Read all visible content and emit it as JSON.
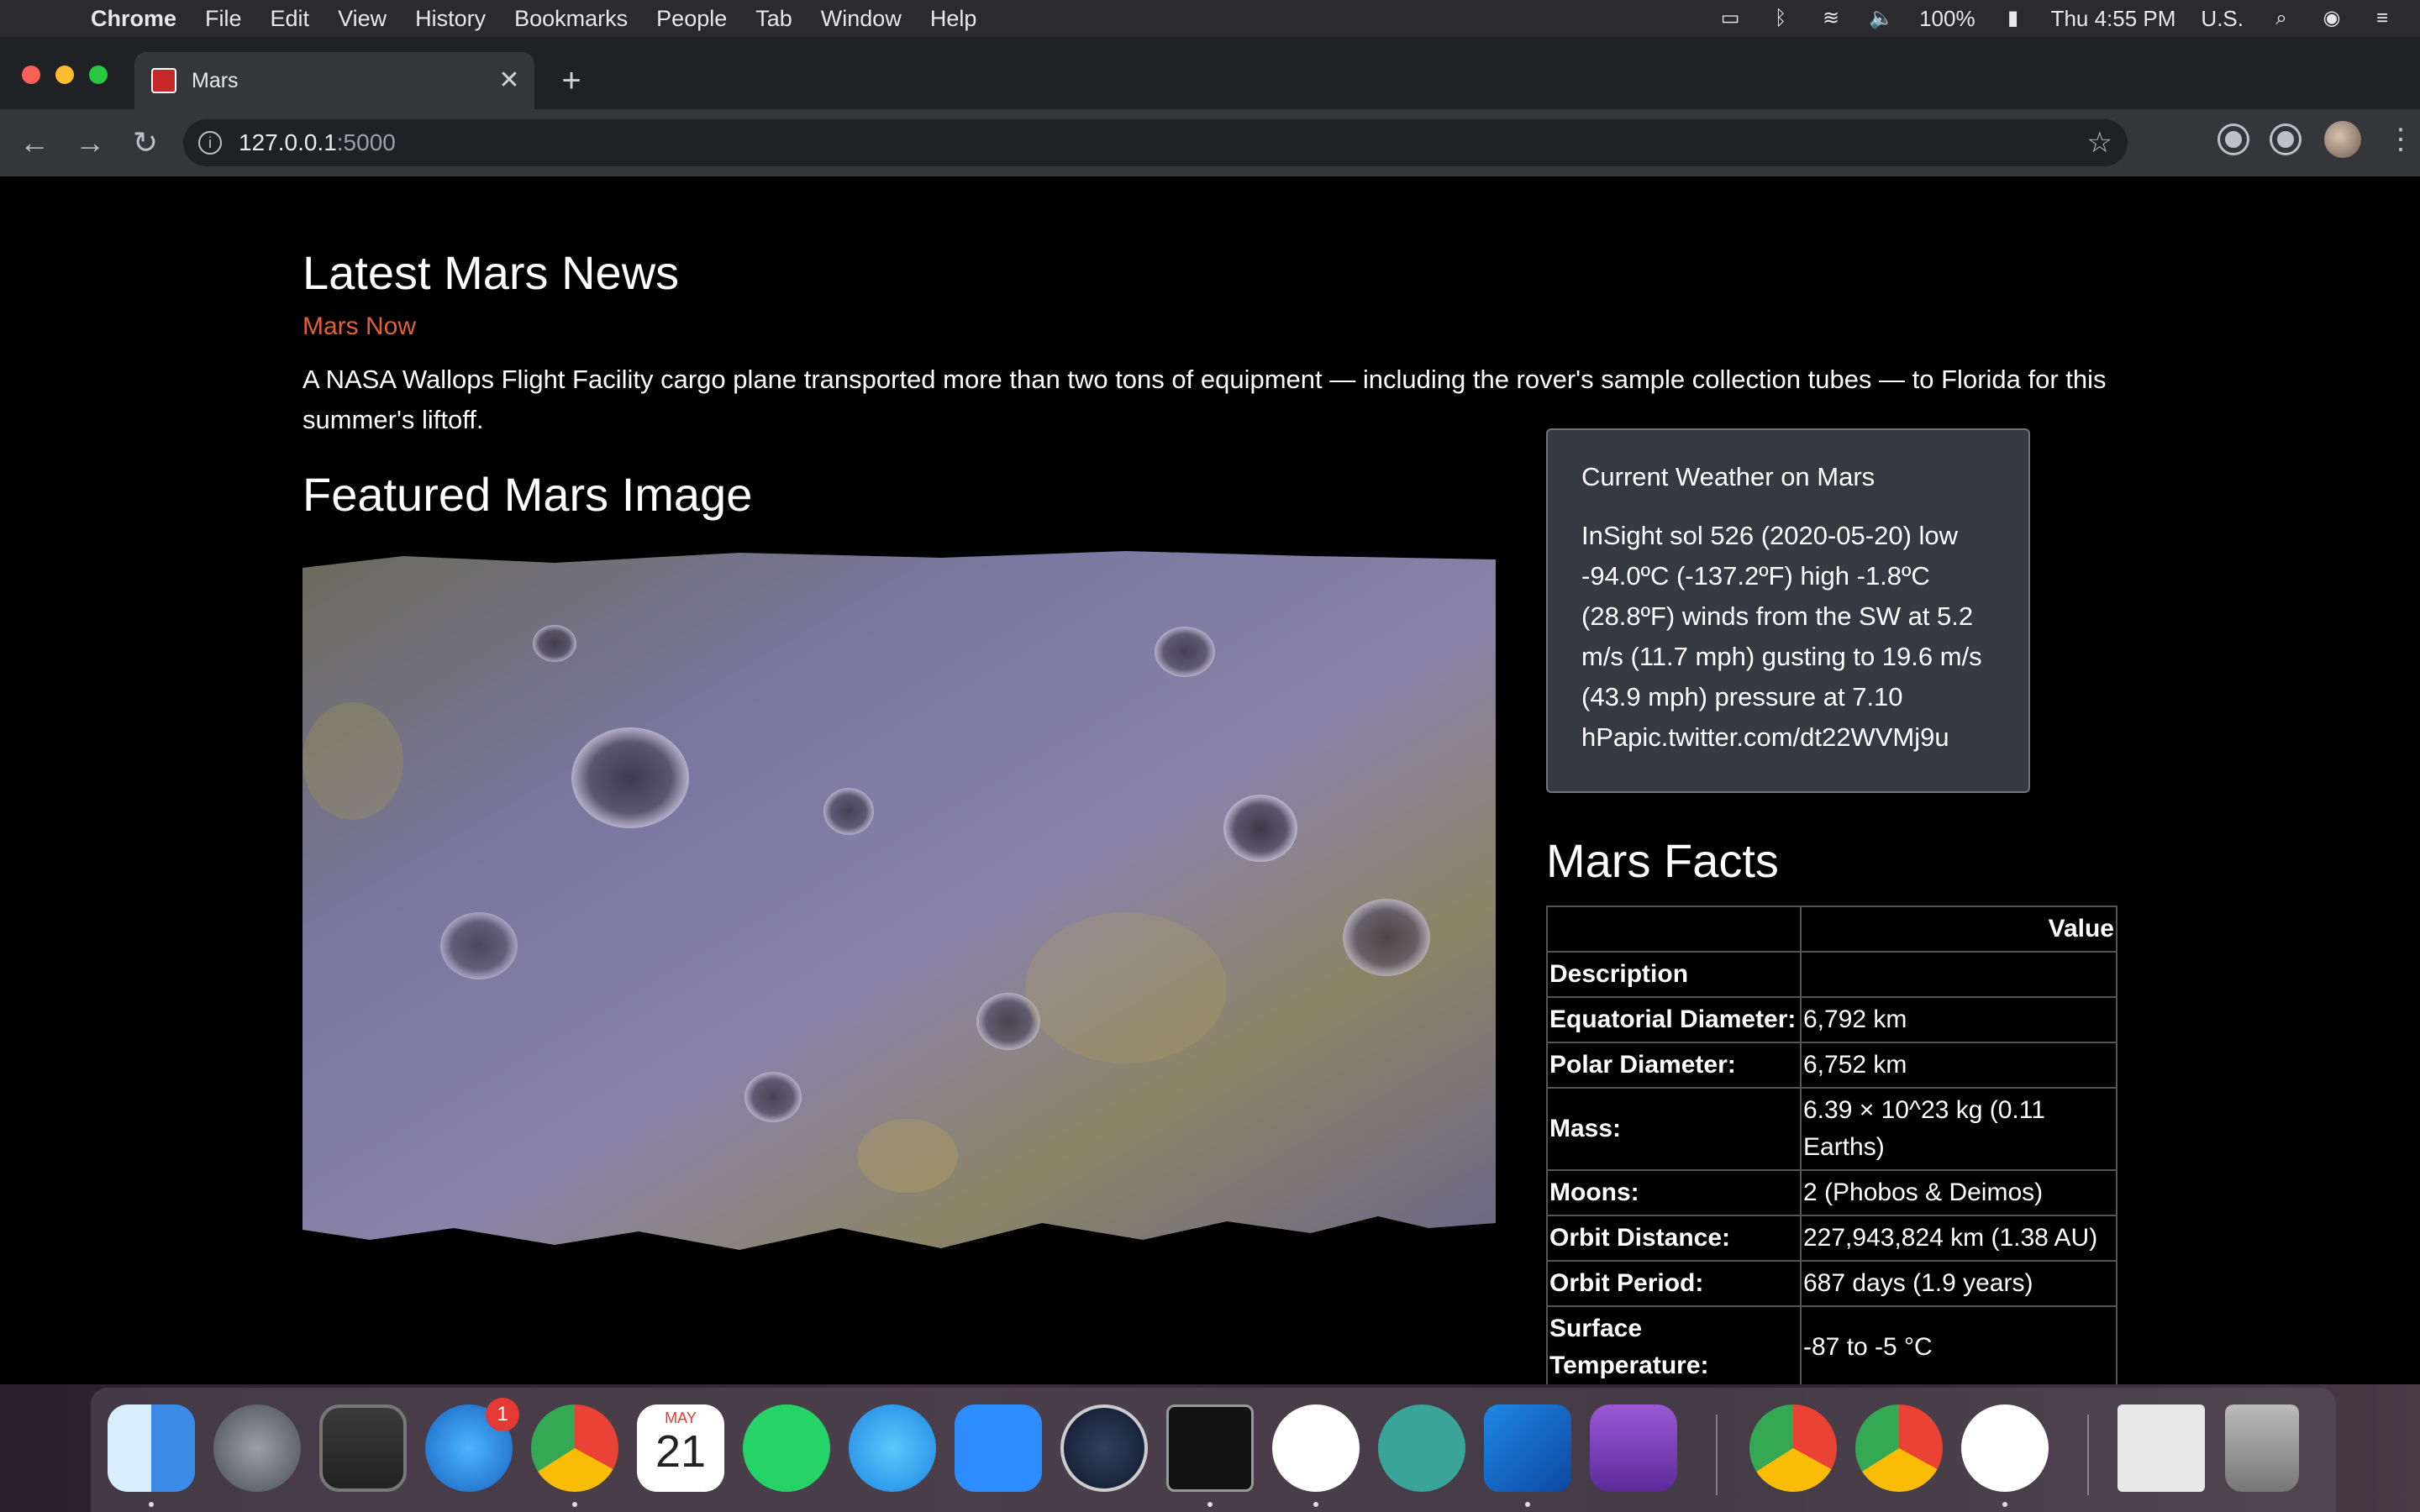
{
  "menubar": {
    "app_name": "Chrome",
    "items": [
      "File",
      "Edit",
      "View",
      "History",
      "Bookmarks",
      "People",
      "Tab",
      "Window",
      "Help"
    ],
    "battery": "100%",
    "clock": "Thu 4:55 PM",
    "input_source": "U.S."
  },
  "browser": {
    "tab_title": "Mars",
    "url_host": "127.0.0.1",
    "url_port": ":5000"
  },
  "page": {
    "news_heading": "Latest Mars News",
    "news_title": "Mars Now",
    "news_paragraph": "A NASA Wallops Flight Facility cargo plane transported more than two tons of equipment — including the rover's sample collection tubes — to Florida for this summer's liftoff.",
    "featured_heading": "Featured Mars Image",
    "weather_title": "Current Weather on Mars",
    "weather_text": "InSight sol 526 (2020-05-20) low -94.0ºC (-137.2ºF) high -1.8ºC (28.8ºF) winds from the SW at 5.2 m/s (11.7 mph) gusting to 19.6 m/s (43.9 mph) pressure at 7.10 hPapic.twitter.com/dt22WVMj9u",
    "facts_heading": "Mars Facts",
    "facts_value_header": "Value",
    "facts_rows": [
      {
        "k": "Description",
        "v": ""
      },
      {
        "k": "Equatorial Diameter:",
        "v": "6,792 km"
      },
      {
        "k": "Polar Diameter:",
        "v": "6,752 km"
      },
      {
        "k": "Mass:",
        "v": "6.39 × 10^23 kg (0.11 Earths)"
      },
      {
        "k": "Moons:",
        "v": "2 (Phobos & Deimos)"
      },
      {
        "k": "Orbit Distance:",
        "v": "227,943,824 km (1.38 AU)"
      },
      {
        "k": "Orbit Period:",
        "v": "687 days (1.9 years)"
      },
      {
        "k": "Surface Temperature:",
        "v": "-87 to -5 °C"
      }
    ]
  },
  "dock": {
    "calendar_month": "MAY",
    "calendar_day": "21",
    "app_store_badge": "1"
  }
}
